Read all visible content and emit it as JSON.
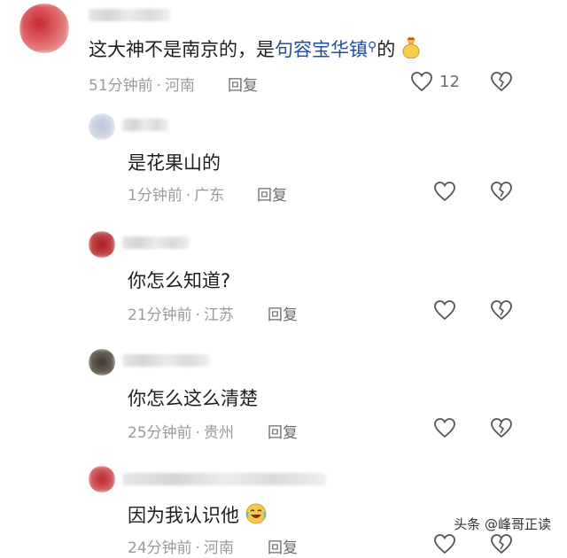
{
  "comments": [
    {
      "text_prefix": "这大神不是南京的，是",
      "link_text": "句容宝华镇",
      "text_suffix": "的",
      "time": "51分钟前",
      "location": "河南",
      "reply_label": "回复",
      "like_count": "12"
    },
    {
      "text": "是花果山的",
      "time": "1分钟前",
      "location": "广东",
      "reply_label": "回复"
    },
    {
      "text": "你怎么知道?",
      "time": "21分钟前",
      "location": "江苏",
      "reply_label": "回复"
    },
    {
      "text": "你怎么这么清楚",
      "time": "25分钟前",
      "location": "贵州",
      "reply_label": "回复"
    },
    {
      "text": "因为我认识他",
      "time": "24分钟前",
      "location": "河南",
      "reply_label": "回复"
    }
  ],
  "icons": {
    "like": "heart-outline-icon",
    "dislike": "broken-heart-icon",
    "search_glyph": "search-icon",
    "emoji_1": "money-bag-emoji",
    "emoji_2": "laughing-crying-emoji"
  },
  "watermark": "头条 @峰哥正读",
  "colors": {
    "link": "#1f4f9e",
    "meta": "#9a9a9a",
    "text": "#1e1e1e"
  }
}
